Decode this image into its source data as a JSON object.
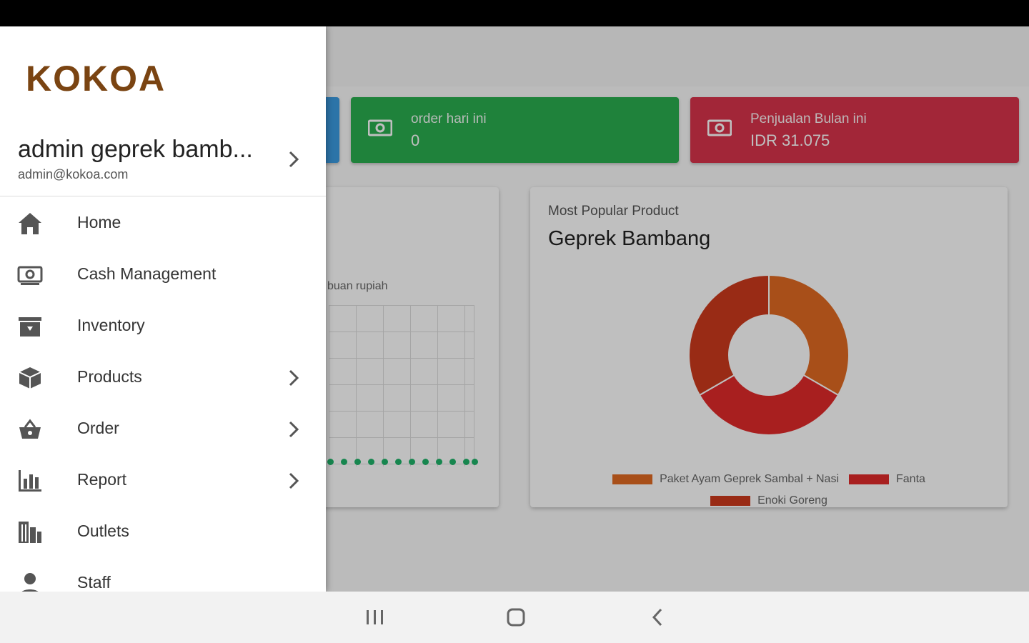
{
  "cards": {
    "orders": {
      "label": "order hari ini",
      "value": "0",
      "color": "#2aae4f"
    },
    "monthly_sales": {
      "label": "Penjualan Bulan ini",
      "value": "IDR 31.075",
      "color": "#d8334b"
    }
  },
  "sales_panel": {
    "axis_label": "buan rupiah"
  },
  "popular_panel": {
    "subtitle": "Most Popular Product",
    "title": "Geprek Bambang",
    "chart_data": {
      "type": "pie",
      "categories": [
        "Paket Ayam Geprek Sambal + Nasi",
        "Fanta",
        "Enoki Goreng"
      ],
      "values": [
        1,
        1,
        1
      ],
      "colors": [
        "#e06a22",
        "#e02a2a",
        "#cc3a1c"
      ]
    },
    "legend": [
      {
        "label": "Paket Ayam Geprek Sambal + Nasi",
        "color": "#e06a22"
      },
      {
        "label": "Fanta",
        "color": "#e02a2a"
      },
      {
        "label": "Enoki Goreng",
        "color": "#cc3a1c"
      }
    ]
  },
  "drawer": {
    "logo": "KOKOA",
    "user_name": "admin geprek bamb...",
    "user_email": "admin@kokoa.com",
    "menu": [
      {
        "label": "Home",
        "icon": "home-icon"
      },
      {
        "label": "Cash Management",
        "icon": "cash-icon"
      },
      {
        "label": "Inventory",
        "icon": "archive-icon"
      },
      {
        "label": "Products",
        "icon": "cube-icon"
      },
      {
        "label": "Order",
        "icon": "basket-icon"
      },
      {
        "label": "Report",
        "icon": "bar-chart-icon"
      },
      {
        "label": "Outlets",
        "icon": "building-icon"
      },
      {
        "label": "Staff",
        "icon": "person-icon"
      }
    ]
  }
}
